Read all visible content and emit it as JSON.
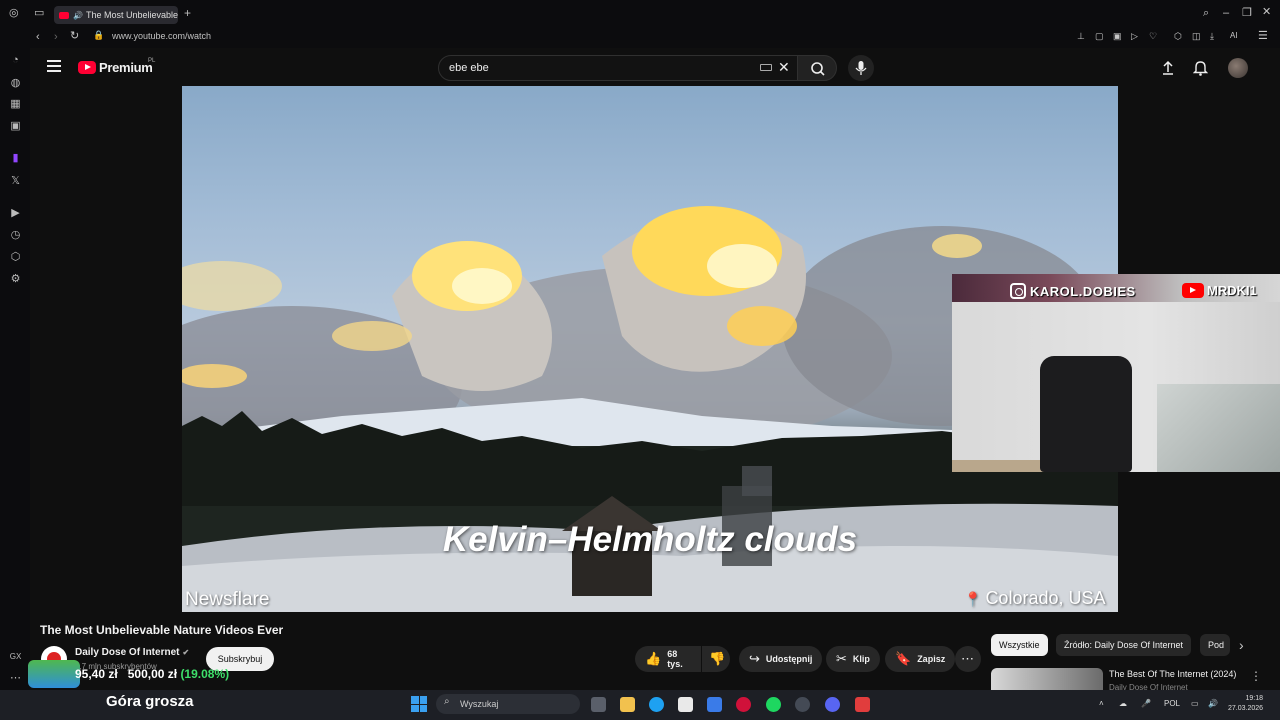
{
  "browser": {
    "tab_title": "The Most Unbelievable",
    "url": "www.youtube.com/watch"
  },
  "youtube": {
    "logo_text": "Premium",
    "logo_region": "PL",
    "search_value": "ebe ebe"
  },
  "video": {
    "caption": "Kelvin–Helmholtz clouds",
    "watermark": "Newsflare",
    "location": "Colorado, USA"
  },
  "webcam": {
    "instagram": "KAROL.DOBIES",
    "youtube": "MRDKI1"
  },
  "meta": {
    "title": "The Most Unbelievable Nature Videos Ever",
    "channel": "Daily Dose Of Internet",
    "subscribers": "8,7 mln subskrybentów",
    "subscribe_label": "Subskrybuj",
    "likes": "68 tys.",
    "share_label": "Udostępnij",
    "clip_label": "Klip",
    "save_label": "Zapisz"
  },
  "chips": [
    "Wszystkie",
    "Źródło: Daily Dose Of Internet",
    "Pod"
  ],
  "recommendation": {
    "title": "The Best Of The Internet (2024)",
    "channel": "Daily Dose Of Internet"
  },
  "stock": {
    "value": "95,40 zł",
    "target": "500,00 zł",
    "change": "(19.08%)"
  },
  "taskbar": {
    "widget_text": "Góra grosza",
    "search_placeholder": "Wyszukaj",
    "language": "POL",
    "time": "19:18",
    "date": "27.03.2026"
  },
  "colors": {
    "youtube_red": "#ff0033",
    "background": "#0f0f0f",
    "stock_green": "#3ee06a"
  }
}
